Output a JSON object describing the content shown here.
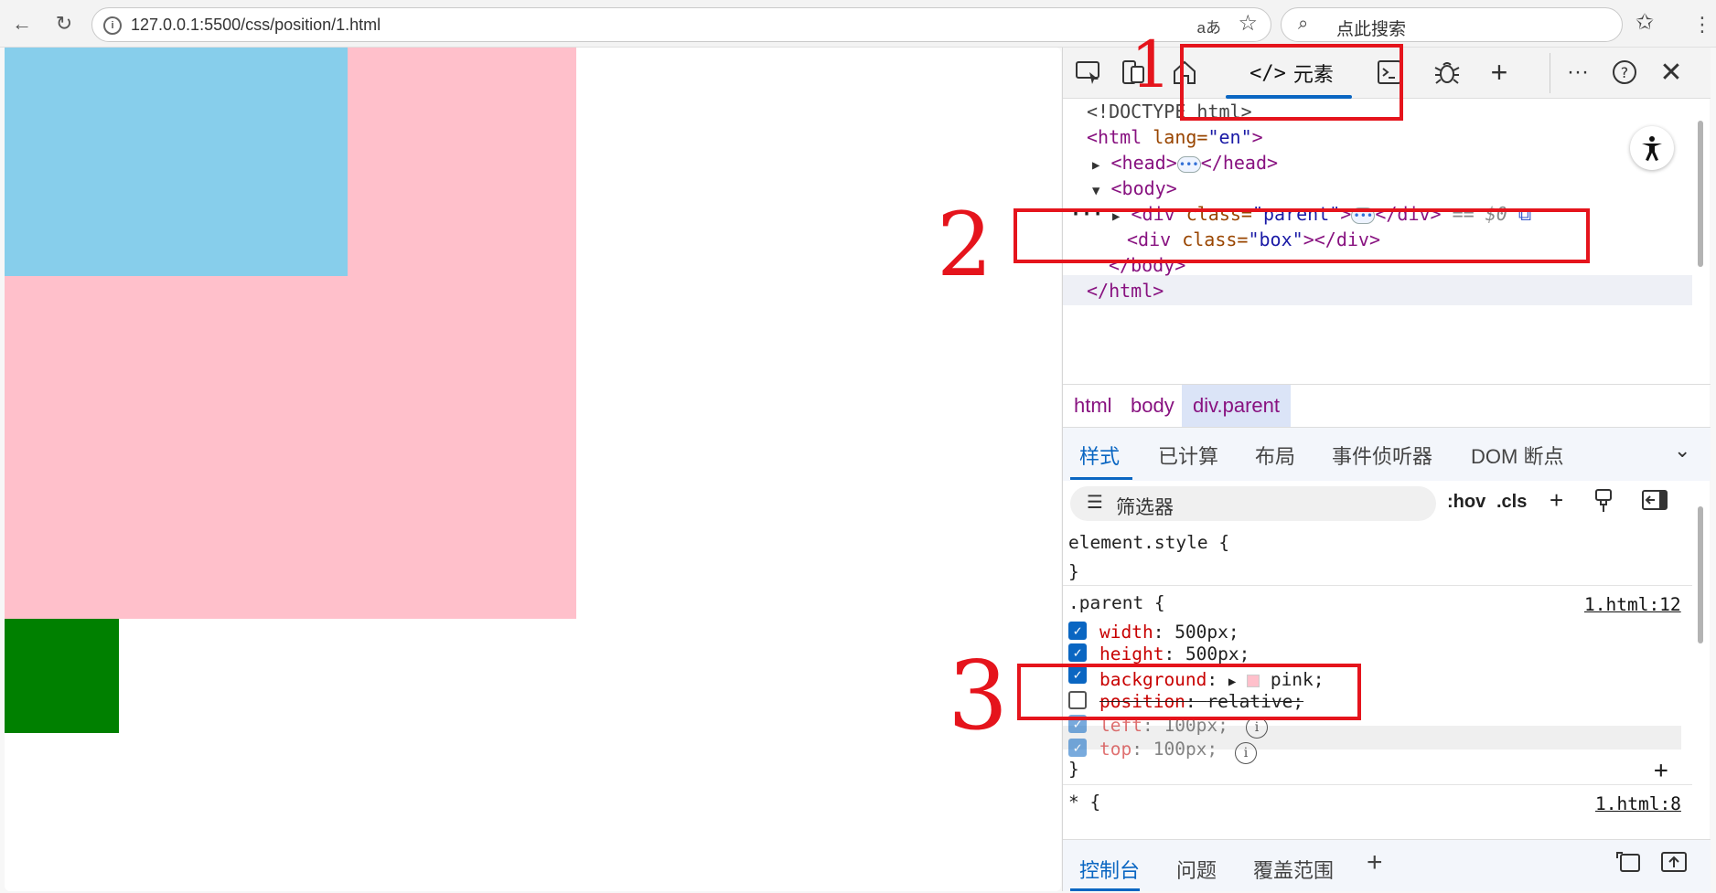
{
  "browser": {
    "url": "127.0.0.1:5500/css/position/1.html",
    "search_placeholder": "点此搜索",
    "read_aloud": "aあ"
  },
  "devtools": {
    "main_tabs": {
      "elements_label": "元素"
    },
    "dom": {
      "doctype": "<!DOCTYPE html>",
      "html_open_tag": "<html",
      "html_lang_attr": " lang=",
      "html_lang_val": "\"en\"",
      "head_open": "<head>",
      "head_close": "</head>",
      "body_open": "<body>",
      "div_open": "<div",
      "div_class_attr": " class=",
      "div_parent_val": "\"parent\"",
      "div_close": "</div>",
      "selected_marker": "== $0",
      "box_val": "\"box\"",
      "body_close": "</body>",
      "html_close": "</html>"
    },
    "breadcrumbs": [
      "html",
      "body",
      "div.parent"
    ],
    "style_tabs": [
      "样式",
      "已计算",
      "布局",
      "事件侦听器",
      "DOM 断点"
    ],
    "filter_placeholder": "筛选器",
    "filter_buttons": [
      ":hov",
      ".cls"
    ],
    "styles": {
      "element_style_selector": "element.style {",
      "close_brace": "}",
      "parent_selector": ".parent {",
      "parent_source": "1.html:12",
      "declarations": [
        {
          "prop": "width",
          "value": "500px;",
          "checked": true
        },
        {
          "prop": "height",
          "value": "500px;",
          "checked": true
        },
        {
          "prop": "background",
          "value": "pink;",
          "checked": true
        },
        {
          "prop": "position",
          "value": "relative;",
          "checked": false
        },
        {
          "prop": "left",
          "value": "100px;",
          "checked": true
        },
        {
          "prop": "top",
          "value": "100px;",
          "checked": true
        }
      ],
      "universal_selector": "* {",
      "universal_source": "1.html:8"
    },
    "bottom_tabs": [
      "控制台",
      "问题",
      "覆盖范围"
    ]
  },
  "annotations": [
    "1",
    "2",
    "3"
  ],
  "colors": {
    "parent_bg": "#ffc0cb",
    "skyblue_box": "#87ceeb",
    "green_box": "#008000",
    "annotation": "#e5141c",
    "accent": "#0a66c2"
  }
}
